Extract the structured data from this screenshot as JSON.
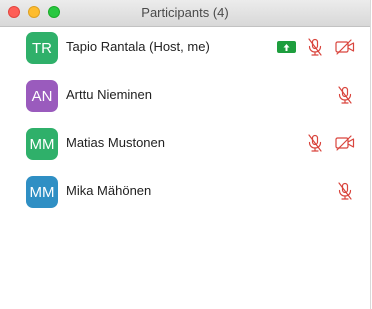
{
  "window": {
    "title": "Participants (4)"
  },
  "participants": [
    {
      "initials": "TR",
      "name": "Tapio Rantala (Host, me)",
      "color": "#2fb06a",
      "screen_share": true,
      "mic_muted": true,
      "video_off": true
    },
    {
      "initials": "AN",
      "name": "Arttu Nieminen",
      "color": "#9a5bbd",
      "screen_share": false,
      "mic_muted": true,
      "video_off": false
    },
    {
      "initials": "MM",
      "name": "Matias Mustonen",
      "color": "#2fb06a",
      "screen_share": false,
      "mic_muted": true,
      "video_off": true
    },
    {
      "initials": "MM",
      "name": "Mika Mähönen",
      "color": "#2f8fc4",
      "screen_share": false,
      "mic_muted": true,
      "video_off": false
    }
  ],
  "colors": {
    "muted_red": "#d9453d",
    "share_green": "#1e9e3e"
  }
}
